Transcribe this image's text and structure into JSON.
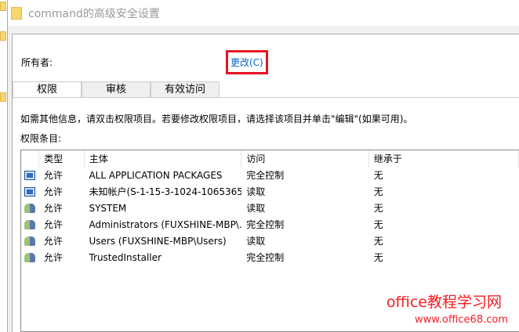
{
  "window": {
    "title": "command的高级安全设置"
  },
  "owner": {
    "label": "所有者:",
    "change_label": "更改(C)"
  },
  "tabs": [
    {
      "label": "权限"
    },
    {
      "label": "审核"
    },
    {
      "label": "有效访问"
    }
  ],
  "info_text": "如需其他信息，请双击权限项目。若要修改权限项目，请选择该项目并单击\"编辑\"(如果可用)。",
  "entries_label": "权限条目:",
  "table": {
    "columns": [
      "类型",
      "主体",
      "访问",
      "继承于"
    ],
    "rows": [
      {
        "icon": "app-package-icon",
        "type": "允许",
        "principal": "ALL APPLICATION PACKAGES",
        "access": "完全控制",
        "inherited": "无"
      },
      {
        "icon": "app-package-icon",
        "type": "允许",
        "principal": "未知帐户(S-1-15-3-1024-1065365...",
        "access": "读取",
        "inherited": "无"
      },
      {
        "icon": "user-group-icon",
        "type": "允许",
        "principal": "SYSTEM",
        "access": "读取",
        "inherited": "无"
      },
      {
        "icon": "user-group-icon",
        "type": "允许",
        "principal": "Administrators (FUXSHINE-MBP\\...",
        "access": "完全控制",
        "inherited": "无"
      },
      {
        "icon": "user-group-icon",
        "type": "允许",
        "principal": "Users (FUXSHINE-MBP\\Users)",
        "access": "读取",
        "inherited": "无"
      },
      {
        "icon": "user-group-icon",
        "type": "允许",
        "principal": "TrustedInstaller",
        "access": "完全控制",
        "inherited": "无"
      }
    ]
  },
  "watermark": {
    "line1": "office教程学习网",
    "line2": "www.office68.com"
  },
  "colors": {
    "link": "#0066cc",
    "highlight": "#e81123",
    "watermark": "#f41c24"
  }
}
